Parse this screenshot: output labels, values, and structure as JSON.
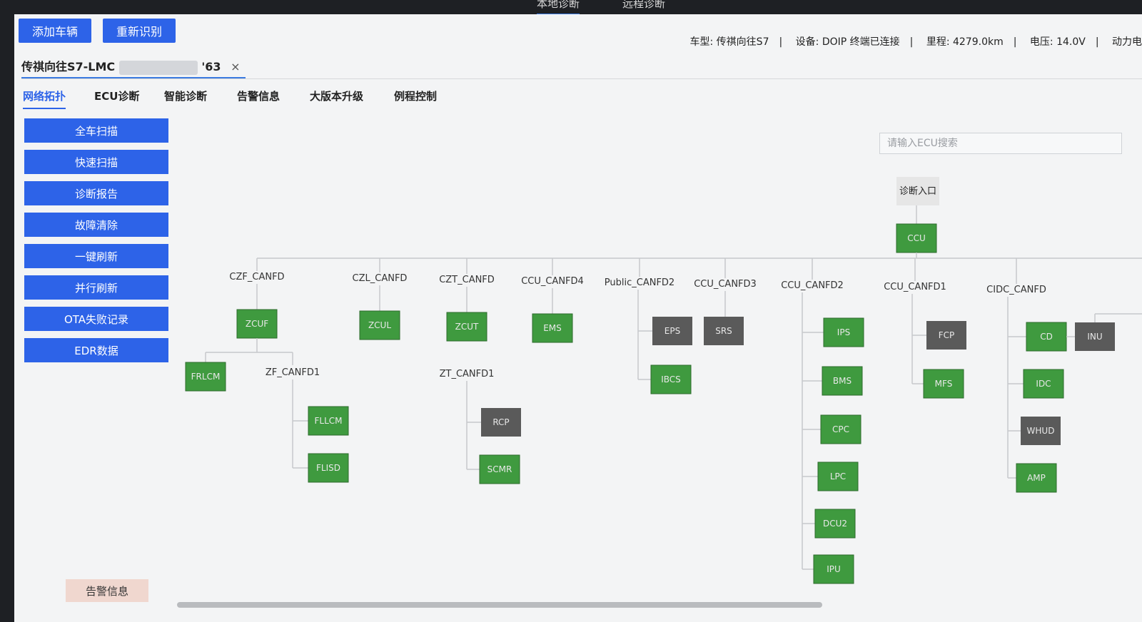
{
  "top_tabs": [
    "本地诊断",
    "远程诊断"
  ],
  "header": {
    "add_vehicle": "添加车辆",
    "re_identify": "重新识别",
    "status": [
      "车型: 传祺向往S7",
      "设备: DOIP 终端已连接",
      "里程: 4279.0km",
      "电压: 14.0V",
      "动力电"
    ]
  },
  "vehicle_tab": {
    "prefix": "传祺向往S7-LMC",
    "suffix": "'63",
    "close": "×"
  },
  "nav_tabs": [
    "网络拓扑",
    "ECU诊断",
    "智能诊断",
    "告警信息",
    "大版本升级",
    "例程控制"
  ],
  "sidebar": [
    "全车扫描",
    "快速扫描",
    "诊断报告",
    "故障清除",
    "一键刷新",
    "并行刷新",
    "OTA失败记录",
    "EDR数据"
  ],
  "alert_button": "告警信息",
  "search": {
    "placeholder": "请输入ECU搜索"
  },
  "topology": {
    "entry": "诊断入口",
    "root": "CCU",
    "colors": {
      "online": "#3f9a3f",
      "offline": "#5a5a5a",
      "entry_bg": "#e6e6e6"
    },
    "buses": [
      {
        "name": "CZF_CANFD",
        "nodes": [
          {
            "name": "ZCUF",
            "status": "online"
          }
        ]
      },
      {
        "name": "CZL_CANFD",
        "nodes": [
          {
            "name": "ZCUL",
            "status": "online"
          }
        ]
      },
      {
        "name": "CZT_CANFD",
        "nodes": [
          {
            "name": "ZCUT",
            "status": "online"
          }
        ]
      },
      {
        "name": "CCU_CANFD4",
        "nodes": [
          {
            "name": "EMS",
            "status": "online"
          }
        ]
      },
      {
        "name": "Public_CANFD2",
        "nodes": [
          {
            "name": "EPS",
            "status": "offline"
          },
          {
            "name": "IBCS",
            "status": "online"
          }
        ]
      },
      {
        "name": "CCU_CANFD3",
        "nodes": [
          {
            "name": "SRS",
            "status": "offline"
          }
        ]
      },
      {
        "name": "CCU_CANFD2",
        "nodes": [
          {
            "name": "IPS",
            "status": "online"
          },
          {
            "name": "BMS",
            "status": "online"
          },
          {
            "name": "CPC",
            "status": "online"
          },
          {
            "name": "LPC",
            "status": "online"
          },
          {
            "name": "DCU2",
            "status": "online"
          },
          {
            "name": "IPU",
            "status": "online"
          }
        ]
      },
      {
        "name": "CCU_CANFD1",
        "nodes": [
          {
            "name": "FCP",
            "status": "offline"
          },
          {
            "name": "MFS",
            "status": "online"
          }
        ]
      },
      {
        "name": "CIDC_CANFD",
        "nodes": [
          {
            "name": "CD",
            "status": "online"
          },
          {
            "name": "IDC",
            "status": "online"
          },
          {
            "name": "WHUD",
            "status": "offline"
          },
          {
            "name": "AMP",
            "status": "online"
          }
        ]
      }
    ],
    "extra_nodes": [
      {
        "name": "INU",
        "status": "offline"
      }
    ],
    "sub_buses": [
      {
        "name": "ZF_CANFD1",
        "nodes": [
          {
            "name": "FLLCM",
            "status": "online"
          },
          {
            "name": "FLISD",
            "status": "online"
          }
        ]
      },
      {
        "name": "ZT_CANFD1",
        "nodes": [
          {
            "name": "RCP",
            "status": "offline"
          },
          {
            "name": "SCMR",
            "status": "online"
          }
        ]
      }
    ],
    "zcuf_child": {
      "name": "FRLCM",
      "status": "online"
    }
  }
}
